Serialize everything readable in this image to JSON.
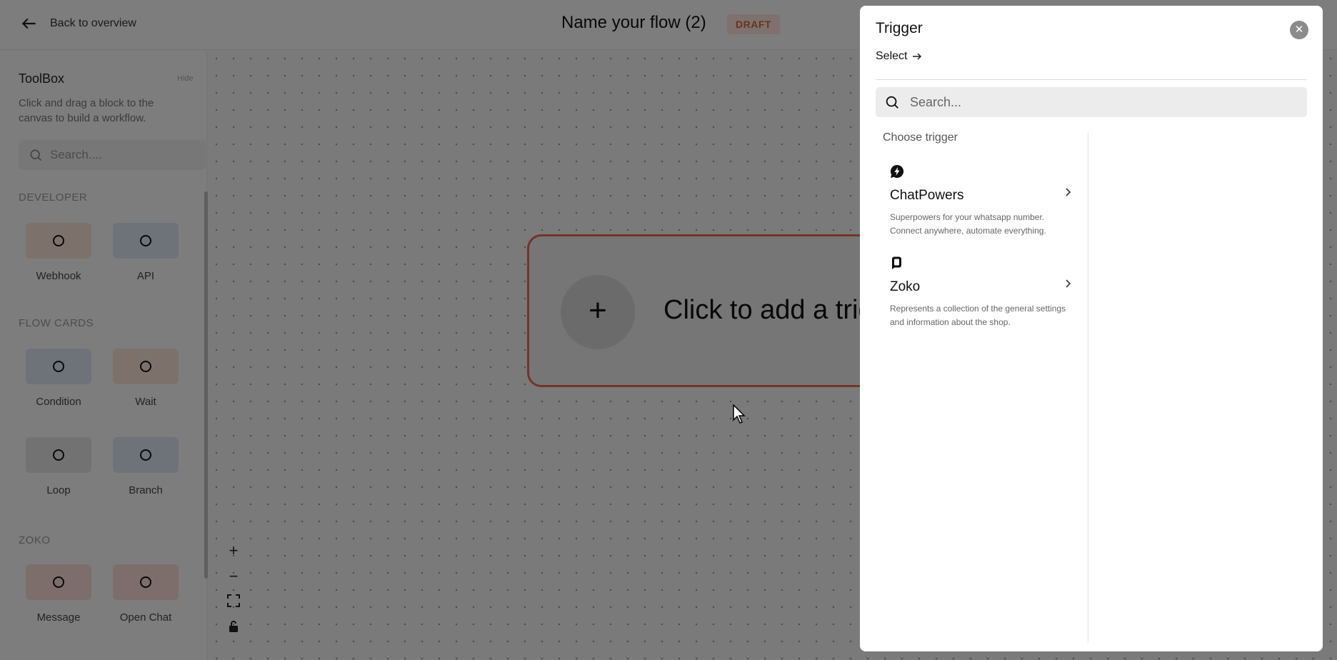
{
  "header": {
    "back_label": "Back to overview",
    "flow_title": "Name your flow (2)",
    "status_badge": "DRAFT"
  },
  "toolbox": {
    "title": "ToolBox",
    "hide_label": "Hide",
    "description": "Click and drag a block to the canvas to build a workflow.",
    "search_placeholder": "Search....",
    "sections": [
      {
        "title": "DEVELOPER",
        "items": [
          {
            "label": "Webhook"
          },
          {
            "label": "API"
          }
        ]
      },
      {
        "title": "FLOW CARDS",
        "items": [
          {
            "label": "Condition"
          },
          {
            "label": "Wait"
          },
          {
            "label": "Loop"
          },
          {
            "label": "Branch"
          }
        ]
      },
      {
        "title": "ZOKO",
        "items": [
          {
            "label": "Message"
          },
          {
            "label": "Open Chat"
          }
        ]
      }
    ]
  },
  "canvas": {
    "trigger_card_text": "Click to add a trigger",
    "zoom_controls": [
      "plus-icon",
      "minus-icon",
      "fit-view-icon",
      "lock-icon"
    ]
  },
  "trigger_panel": {
    "title": "Trigger",
    "select_label": "Select",
    "search_placeholder": "Search...",
    "choose_label": "Choose trigger",
    "items": [
      {
        "name": "ChatPowers",
        "description": "Superpowers for your whatsapp number. Connect anywhere, automate everything.",
        "icon": "chatpowers-logo-icon"
      },
      {
        "name": "Zoko",
        "description": "Represents a collection of the general settings and information about the shop.",
        "icon": "zoko-logo-icon"
      }
    ]
  },
  "colors": {
    "accent": "#e66a4f",
    "draft_badge_bg": "#fde3dc",
    "overlay": "rgba(0,0,0,0.5)"
  }
}
